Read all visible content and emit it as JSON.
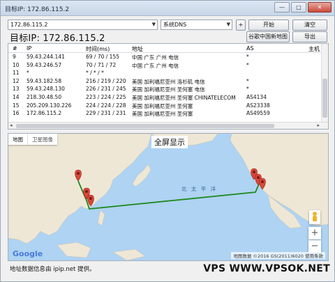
{
  "window": {
    "title": "目标IP: 172.86.115.2",
    "controls": [
      "—",
      "□",
      "✕"
    ]
  },
  "toolbar": {
    "ip_value": "172.86.115.2",
    "dns_value": "系统DNS",
    "plus_label": "+",
    "start_label": "开始",
    "clear_label": "清空",
    "google_map_label": "谷歌中国新地图",
    "export_label": "导出"
  },
  "target_label": "目标IP:  172.86.115.2",
  "table": {
    "headers": [
      "#",
      "IP",
      "时间(ms)",
      "地址",
      "AS",
      "主机"
    ],
    "rows": [
      [
        "9",
        "59.43.244.141",
        "69 / 70 / 155",
        "中国 广东 广州 电信",
        "*",
        ""
      ],
      [
        "10",
        "59.43.246.57",
        "70 / 71 / 72",
        "中国 广东 广州 电信",
        "*",
        ""
      ],
      [
        "11",
        "*",
        "* / * / *",
        "",
        "",
        ""
      ],
      [
        "12",
        "59.43.182.58",
        "216 / 219 / 220",
        "美国 加利福尼亚州 洛杉矶 电信",
        "*",
        ""
      ],
      [
        "13",
        "59.43.248.130",
        "226 / 231 / 245",
        "美国 加利福尼亚州 圣何塞 电信",
        "*",
        ""
      ],
      [
        "14",
        "218.30.48.50",
        "223 / 224 / 225",
        "美国 加利福尼亚州 圣何塞 CHINATELECOM",
        "AS4134",
        ""
      ],
      [
        "15",
        "205.209.130.226",
        "224 / 224 / 228",
        "美国 加利福尼亚州 圣何塞",
        "AS23338",
        ""
      ],
      [
        "16",
        "172.86.115.2",
        "229 / 231 / 231",
        "美国 加利福尼亚州 圣何塞",
        "AS49559",
        ""
      ]
    ]
  },
  "map": {
    "type_map": "地图",
    "type_satellite": "卫星图像",
    "fullscreen_label": "全屏显示",
    "ocean_label": "北 太 平 洋",
    "google_logo": "Google",
    "attribution": "地图数据 ©2016 GS(2011)6020  使用条款",
    "zoom_in": "+",
    "zoom_out": "−",
    "route_color": "#1f8a1f",
    "marker_color": "#d9463b"
  },
  "footer": {
    "source_text": "地址数据信息由 ipip.net 提供。",
    "watermark": "VPS  WWW.VPSOK.NET"
  }
}
